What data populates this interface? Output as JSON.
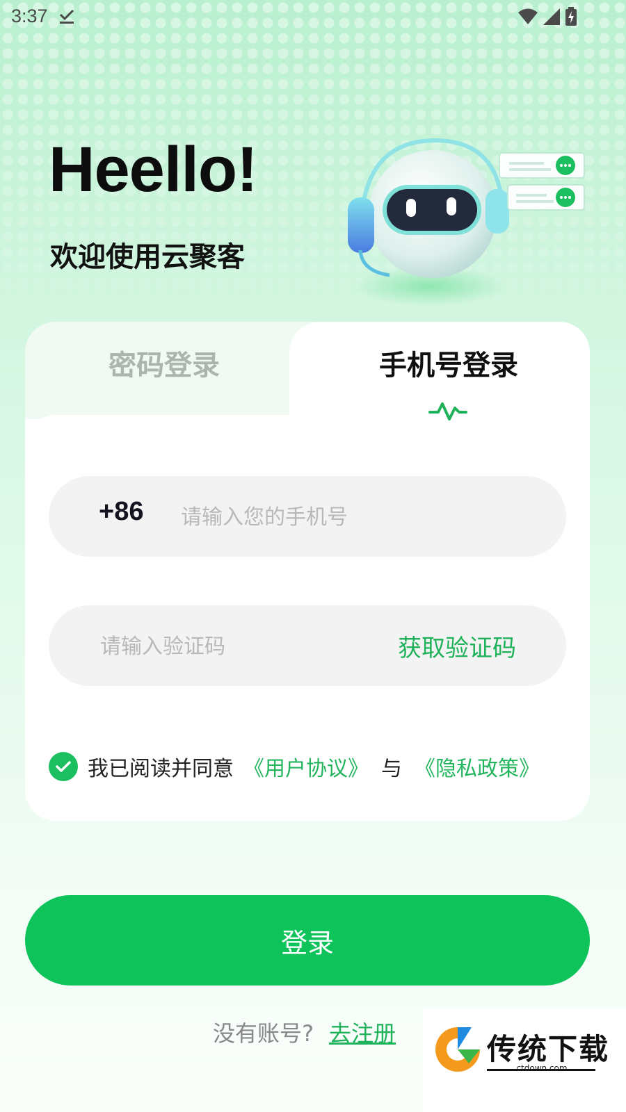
{
  "status_bar": {
    "time": "3:37",
    "icons": [
      "download-done-icon",
      "wifi-icon",
      "signal-icon",
      "battery-charging-icon"
    ]
  },
  "header": {
    "greeting": "Heello!",
    "subtitle": "欢迎使用云聚客"
  },
  "tabs": {
    "password_label": "密码登录",
    "phone_label": "手机号登录",
    "active": "phone"
  },
  "form": {
    "country_code": "+86",
    "phone_placeholder": "请输入您的手机号",
    "code_placeholder": "请输入验证码",
    "get_code_label": "获取验证码"
  },
  "agreement": {
    "checked": true,
    "prefix": "我已阅读并同意",
    "user_agreement": "《用户协议》",
    "and": "与",
    "privacy_policy": "《隐私政策》"
  },
  "login_button": "登录",
  "register": {
    "prompt": "没有账号?",
    "link": "去注册"
  },
  "watermark": {
    "title": "传统下载",
    "domain": "ctdown.com"
  },
  "colors": {
    "accent": "#0dc35a",
    "link": "#1fb25a",
    "background_top": "#b9f0cf"
  }
}
